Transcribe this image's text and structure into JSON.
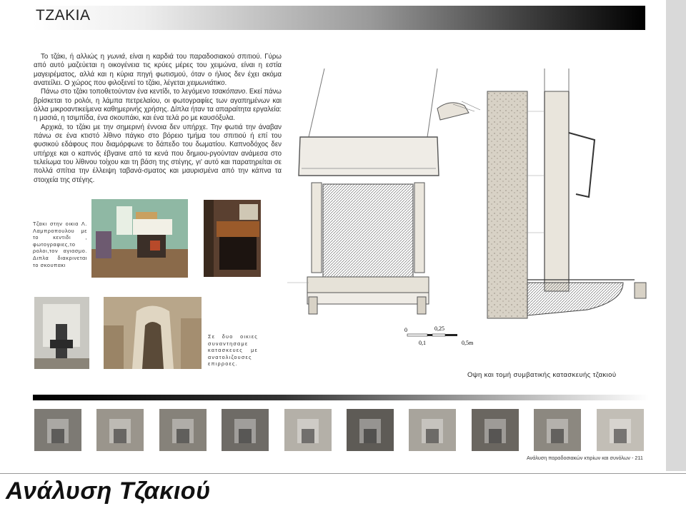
{
  "document": {
    "section_title": "Τζακια",
    "paragraphs": {
      "p1_a": "Το τζάκι, ή αλλιώς η ",
      "p1_b": "γωνιά",
      "p1_c": ", είναι η καρδιά του παραδοσιακού σπιτιού. Γύρω από αυτό μαζεύεται η οικογένεια τις κρύες μέρες του χειμώνα, είναι η εστία μαγειρέματος, αλλά και η κύρια πηγή φωτισμού, όταν ο ήλιος δεν έχει ακόμα ανατείλει. Ο χώρος που φιλοξενεί το τζάκι, λέγεται ",
      "p1_d": "χειμωνιάτικο",
      "p1_e": ".",
      "p2_a": "Πάνω στο τζάκι τοποθετούνταν ένα κεντίδι, το λεγόμενο ",
      "p2_b": "τσακόπανο",
      "p2_c": ". Εκεί πάνω βρίσκεται το ρολόι, η λάμπα πετρελαίου, οι φωτογραφίες των αγαπημένων και άλλα μικροαντικείμενα καθημερινής χρήσης. Δίπλα ήταν τα απαραίτητα εργαλεία: η μασιά, η τσιμπίδα, ένα σκουπάκι, και ένα τελά ρο με καυσόξυλα.",
      "p3": "Αρχικά, το τζάκι με την σημερινή έννοια δεν υπήρχε. Την φωτιά την άναβαν πάνω σε ένα κτιστό λίθινο πάγκο στο βόρειο τμήμα του σπιτιού ή επί του φυσικού εδάφους που διαμόρφωνε το δάπεδο του δωματίου. Καπνοδόχος δεν υπήρχε και ο καπνός έβγαινε από τα κενά που δημιου-ργούνταν ανάμεσα στο τελείωμα του λίθινου τοίχου και τη βάση της στέγης, γι' αυτό και παρατηρείται σε πολλά σπίτια την έλλειψη ταβανά-σματος και μαυρισμένα από την κάπνα τα στοιχεία της στέγης."
    },
    "caption_left": "Τζακι στην οικια Λ. Λαμπροπουλου με το κεντιδι , φωτογραφιες,το ρολοι,τον αγιασμο. Διπλα διακρινεται το σκουπακι",
    "caption_right": "Σε δυο οικιες συναντησαμε κατασκευες με ανατολιζουσες επιρροες.",
    "scale_bar": {
      "zero": "0",
      "quarter": "0,25",
      "tenth": "0,1",
      "half": "0,5m"
    },
    "drawing_caption": "Οψη και τομή συμβατικής κατασκευής τζακιού",
    "footer": "Ανάλυση παραδοσιακών κτιρίων και συνόλων - 211"
  },
  "slide": {
    "title": "Ανάλυση Τζακιού"
  },
  "icons": [
    "fireplace-photo",
    "fireplace-drawing"
  ],
  "colors": {
    "header_dark": "#000000",
    "header_light": "#ffffff",
    "text": "#2b2b2b",
    "side_band": "#d9d9d9"
  },
  "thumbnail_count": 10
}
